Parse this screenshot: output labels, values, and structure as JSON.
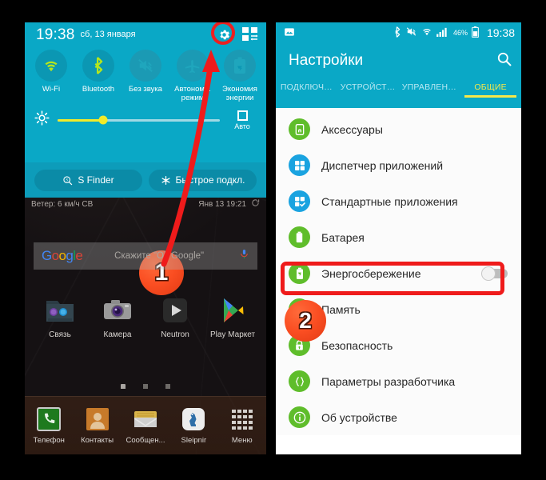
{
  "left_phone": {
    "status": {
      "time": "19:38",
      "date": "сб, 13 января",
      "gear_icon": "gear-icon",
      "grid_icon": "quick-settings-grid-icon"
    },
    "quick_toggles": [
      {
        "label": "Wi-Fi",
        "icon": "wifi-icon",
        "state": "on"
      },
      {
        "label": "Bluetooth",
        "icon": "bluetooth-icon",
        "state": "on"
      },
      {
        "label": "Без звука",
        "icon": "mute-icon",
        "state": "off"
      },
      {
        "label": "Автономн. режим",
        "icon": "airplane-icon",
        "state": "off"
      },
      {
        "label": "Экономия энергии",
        "icon": "power-saving-icon",
        "state": "off"
      }
    ],
    "brightness": {
      "icon": "brightness-icon",
      "auto_label": "Авто",
      "level_percent": 28
    },
    "shortcuts": [
      {
        "label": "S Finder",
        "icon": "s-finder-icon"
      },
      {
        "label": "Быстрое подкл.",
        "icon": "quick-connect-icon"
      }
    ],
    "weather": {
      "wind": "Ветер: 6 км/ч СВ",
      "updated": "Янв 13  19:21",
      "refresh_icon": "refresh-icon"
    },
    "google_bar": {
      "logo": "Google",
      "hint": "Скажите \"Ok Google\"",
      "mic_icon": "microphone-icon"
    },
    "home_apps": [
      {
        "label": "Связь",
        "icon": "contacts-folder-icon"
      },
      {
        "label": "Камера",
        "icon": "camera-icon"
      },
      {
        "label": "Neutron",
        "icon": "neutron-player-icon"
      },
      {
        "label": "Play Маркет",
        "icon": "play-store-icon"
      }
    ],
    "page_dots": 3,
    "page_dots_active": 0,
    "dock_apps": [
      {
        "label": "Телефон",
        "icon": "phone-icon"
      },
      {
        "label": "Контакты",
        "icon": "contacts-icon"
      },
      {
        "label": "Сообщен...",
        "icon": "messages-icon"
      },
      {
        "label": "Sleipnir",
        "icon": "sleipnir-browser-icon"
      },
      {
        "label": "Меню",
        "icon": "app-drawer-icon"
      }
    ]
  },
  "right_phone": {
    "status": {
      "photo_icon": "gallery-icon",
      "bluetooth_icon": "bluetooth-icon",
      "mute_icon": "mute-icon",
      "wifi_icon": "wifi-icon",
      "signal_icon": "signal-icon",
      "battery_percent": "46%",
      "battery_icon": "battery-icon",
      "time": "19:38"
    },
    "appbar": {
      "title": "Настройки",
      "search_icon": "search-icon"
    },
    "tabs": [
      {
        "label": "ПОДКЛЮЧ…",
        "active": false
      },
      {
        "label": "УСТРОЙСТ…",
        "active": false
      },
      {
        "label": "УПРАВЛЕН…",
        "active": false
      },
      {
        "label": "ОБЩИЕ",
        "active": true
      }
    ],
    "settings_items": [
      {
        "label": "Аксессуары",
        "icon": "accessory-icon",
        "icon_color": "green",
        "toggle": false
      },
      {
        "label": "Диспетчер приложений",
        "icon": "app-manager-icon",
        "icon_color": "blue",
        "toggle": false
      },
      {
        "label": "Стандартные приложения",
        "icon": "default-apps-icon",
        "icon_color": "blue",
        "toggle": false
      },
      {
        "label": "Батарея",
        "icon": "battery-icon",
        "icon_color": "green",
        "toggle": false
      },
      {
        "label": "Энергосбережение",
        "icon": "power-saving-icon",
        "icon_color": "green",
        "toggle": true
      },
      {
        "label": "Память",
        "icon": "storage-icon",
        "icon_color": "green",
        "toggle": false
      },
      {
        "label": "Безопасность",
        "icon": "lock-icon",
        "icon_color": "green",
        "toggle": false,
        "highlighted": true
      },
      {
        "label": "Параметры разработчика",
        "icon": "developer-options-icon",
        "icon_color": "green",
        "toggle": false
      },
      {
        "label": "Об устройстве",
        "icon": "about-device-icon",
        "icon_color": "green",
        "toggle": false
      }
    ]
  },
  "annotations": {
    "step1": "1",
    "step2": "2",
    "arrow_color": "#ef1b1b",
    "highlight_color": "#ef1b1b",
    "badge_color": "#fa4e22"
  },
  "colors": {
    "teal": "#0aa8c6",
    "teal_dark": "#0b8ba7",
    "accent_yellow": "#f5e84a",
    "icon_green": "#5fbd2b",
    "icon_blue": "#1aa3e0",
    "page_bg": "#000000"
  }
}
